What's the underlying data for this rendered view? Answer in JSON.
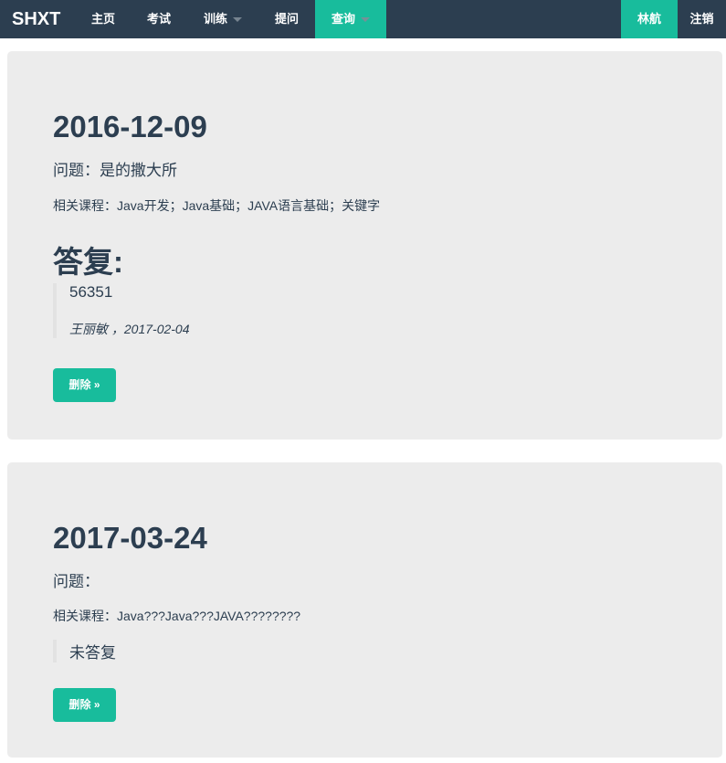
{
  "navbar": {
    "brand": "SHXT",
    "items": [
      {
        "label": "主页"
      },
      {
        "label": "考试"
      },
      {
        "label": "训练"
      },
      {
        "label": "提问"
      },
      {
        "label": "查询"
      }
    ],
    "user": "林航",
    "logout": "注销"
  },
  "questions": [
    {
      "date": "2016-12-09",
      "question": "问题：是的撒大所",
      "courses": "相关课程：Java开发；Java基础；JAVA语言基础；关键字",
      "reply_heading": "答复:",
      "answer": "56351",
      "answer_meta": "王丽敏 ，2017-02-04",
      "delete_label": "删除 »"
    },
    {
      "date": "2017-03-24",
      "question": "问题：",
      "courses": "相关课程：Java???Java???JAVA????????",
      "answer": "未答复",
      "delete_label": "删除 »"
    }
  ],
  "colors": {
    "navbar_bg": "#2c3e50",
    "accent": "#18bc9c",
    "card_bg": "#ececec",
    "text": "#2c3e50"
  }
}
